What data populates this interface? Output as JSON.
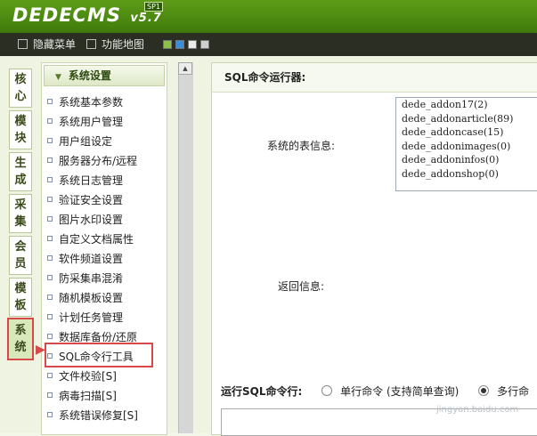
{
  "header": {
    "logo": "DEDECMS",
    "version": "v5.7",
    "edition": "SP1"
  },
  "toolbar": {
    "hide_menu": "隐藏菜单",
    "site_map": "功能地图",
    "swatches": [
      "#8bc34a",
      "#3a8edc",
      "#e9e9e9",
      "#cfcfcf"
    ]
  },
  "side_tabs": [
    {
      "label": "核心"
    },
    {
      "label": "模块"
    },
    {
      "label": "生成"
    },
    {
      "label": "采集"
    },
    {
      "label": "会员"
    },
    {
      "label": "模板"
    },
    {
      "label": "系统"
    }
  ],
  "menu": {
    "title": "系统设置",
    "items": [
      "系统基本参数",
      "系统用户管理",
      "用户组设定",
      "服务器分布/远程",
      "系统日志管理",
      "验证安全设置",
      "图片水印设置",
      "自定义文档属性",
      "软件频道设置",
      "防采集串混淆",
      "随机模板设置",
      "计划任务管理",
      "数据库备份/还原",
      "SQL命令行工具",
      "文件校验[S]",
      "病毒扫描[S]",
      "系统错误修复[S]"
    ]
  },
  "main": {
    "title": "SQL命令运行器:",
    "tables_label": "系统的表信息:",
    "tables": [
      "dede_addon17(2)",
      "dede_addonarticle(89)",
      "dede_addoncase(15)",
      "dede_addonimages(0)",
      "dede_addoninfos(0)",
      "dede_addonshop(0)"
    ],
    "return_label": "返回信息:",
    "run_label": "运行SQL命令行:",
    "single_label": "单行命令 (支持简单查询)",
    "multi_label": "多行命"
  },
  "watermark": "jingyan.baidu.com"
}
